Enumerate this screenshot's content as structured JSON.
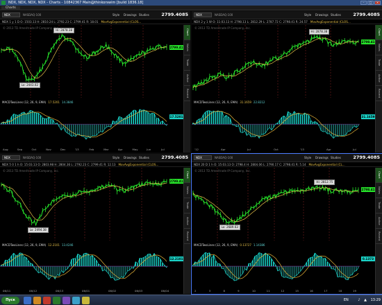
{
  "window": {
    "title": "NDX, NDX, NDX, NDX - Charts - 10842367 Main@thinkorswim [build 1836.18]"
  },
  "tab": {
    "label": "Charts"
  },
  "panes": [
    {
      "symbol": "NDX",
      "agg": "NASDAQ-100",
      "last": "2799.4085",
      "info": "NDX 1 y 1 D  O: 1503.13  H: 2810.24  L: 2792.23  C: 2799.41  R: 18.01",
      "ma": "MovAvgExponential (CLOS...",
      "copyright": "© 2013 TD Ameritrade IP Company, Inc.",
      "macd": {
        "title": "MACDTwoLines (12, 26, 9, EMA)",
        "v1": "17.5201",
        "v2": "14.3846"
      },
      "price_badge": "2799.41",
      "macd_badge": "17.5201",
      "callouts": {
        "hi": "Hi: 2878.38",
        "lo": "Lo: 2443.02"
      },
      "xticks": [
        "Aug",
        "Sep",
        "Oct",
        "Nov",
        "Dec",
        "'13",
        "Feb",
        "Mar",
        "Apr",
        "May",
        "Jun",
        "Jul"
      ]
    },
    {
      "symbol": "NDX",
      "agg": "NASDAQ-100",
      "last": "2799.4085",
      "info": "NDX 2 y 1 W  O: 11:03.13  H: 2798.13  L: 2812.29  L: 2787.72  C: 2798.41  R: 24.57",
      "ma": "MovAvgExponential (CLOS...",
      "copyright": "© 2013 TD Ameritrade IP Company, Inc.",
      "macd": {
        "title": "MACDTwoLines (12, 26, 9, EMA)",
        "v1": "31.1659",
        "v2": "22.8212"
      },
      "price_badge": "2798.41",
      "macd_badge": "31.1659",
      "callouts": {
        "hi": "Hi: 2878.38",
        "lo": ""
      },
      "xticks": [
        "'12",
        "Apr",
        "Jul",
        "Oct",
        "'13",
        "Apr",
        "Jul"
      ]
    },
    {
      "symbol": "NDX",
      "agg": "NASDAQ-100",
      "last": "2799.4085",
      "info": "NDX 5 0 1 h  O: 15:03.13  O: 2803.98  H: 2804.36  L: 2792.23  C: 2799.41  R: 12.13",
      "ma": "MovAvgExponential (CLOS...",
      "copyright": "© 2013 TD Ameritrade IP Company, Inc.",
      "macd": {
        "title": "MACDTwoLines (12, 26, 9, EMA)",
        "v1": "12.2101",
        "v2": "13.4246"
      },
      "price_badge": "2799.41",
      "macd_badge": "12.2101",
      "callouts": {
        "hi": "",
        "lo": "Lo: 2494.38"
      },
      "xticks": [
        "06/11",
        "06/12",
        "06/13",
        "06/01",
        "06/02",
        "06/03",
        "06/04"
      ]
    },
    {
      "symbol": "NDX",
      "agg": "NASDAQ-100",
      "last": "2799.4085",
      "info": "NDX 20 D 1 h  O: 15:03.13  O: 2798.4  H: 2804.06  L: 2790.17  C: 2798.41  R: 5.14",
      "ma": "MovAvgExponential (CL...",
      "copyright": "© 2013 TD Ameritrade IP Company, Inc.",
      "macd": {
        "title": "MACDTwoLines (12, 26, 9, EMA)",
        "v1": "0.13727",
        "v2": "1.14386"
      },
      "price_badge": "2798.41",
      "macd_badge": "0.1373",
      "callouts": {
        "hi": "Hi: 2812.75",
        "lo": "Lo: 2689.63"
      },
      "xticks": [
        "2",
        "3",
        "8",
        "9",
        "10",
        "11",
        "12",
        "15",
        "16",
        "17",
        "18",
        "19"
      ]
    }
  ],
  "header_buttons": {
    "style": "Style",
    "drawings": "Drawings",
    "studies": "Studies"
  },
  "sidebar_labels": [
    "Chart",
    "Notes",
    "Trade",
    "Active",
    "Recent"
  ],
  "colors": {
    "price": "#27e42a",
    "macd_pos": "#1ad3c8",
    "macd_neg": "#1b6f6a",
    "signal": "#e8b43a",
    "accent": "#4a7cff"
  },
  "taskbar": {
    "start": "Пуск",
    "lang": "EN",
    "time": "13:29"
  }
}
